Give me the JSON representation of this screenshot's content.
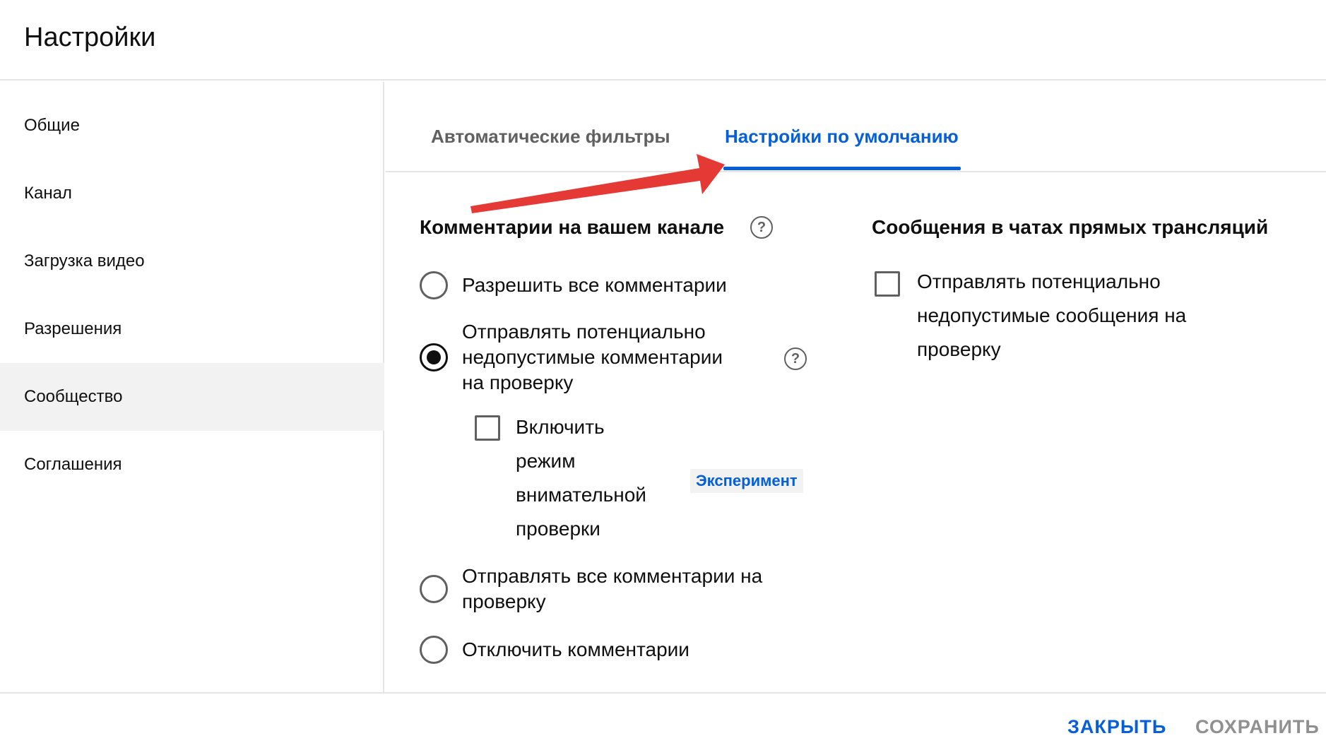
{
  "header": {
    "title": "Настройки"
  },
  "sidebar": {
    "items": [
      {
        "label": "Общие"
      },
      {
        "label": "Канал"
      },
      {
        "label": "Загрузка видео"
      },
      {
        "label": "Разрешения"
      },
      {
        "label": "Сообщество"
      },
      {
        "label": "Соглашения"
      }
    ],
    "active_index": 4
  },
  "tabs": [
    {
      "label": "Автоматические фильтры"
    },
    {
      "label": "Настройки по умолчанию"
    }
  ],
  "active_tab": 1,
  "comments": {
    "title": "Комментарии на вашем канале",
    "help_symbol": "?",
    "options": [
      {
        "label": "Разрешить все комментарии",
        "checked": false
      },
      {
        "label_lines": [
          "Отправлять потенциально",
          "недопустимые комментарии",
          "на проверку"
        ],
        "checked": true,
        "help_symbol": "?"
      },
      {
        "label_lines": [
          "Отправлять все комментарии на",
          "проверку"
        ],
        "checked": false
      },
      {
        "label": "Отключить комментарии",
        "checked": false
      }
    ],
    "strict_mode": {
      "label_lines": [
        "Включить",
        "режим",
        "внимательной",
        "проверки"
      ],
      "checked": false,
      "badge": "Эксперимент"
    }
  },
  "live_chat": {
    "title": "Сообщения в чатах прямых трансляций",
    "option": {
      "label_lines": [
        "Отправлять потенциально",
        "недопустимые сообщения на",
        "проверку"
      ],
      "checked": false
    }
  },
  "footer": {
    "close_label": "ЗАКРЫТЬ",
    "save_label": "СОХРАНИТЬ"
  },
  "colors": {
    "accent": "#065fd4",
    "annotation_arrow": "#e53935",
    "active_item_bg": "#f2f2f2"
  },
  "icons": {
    "help": "question-circle-icon",
    "annotation": "red-arrow-icon"
  }
}
